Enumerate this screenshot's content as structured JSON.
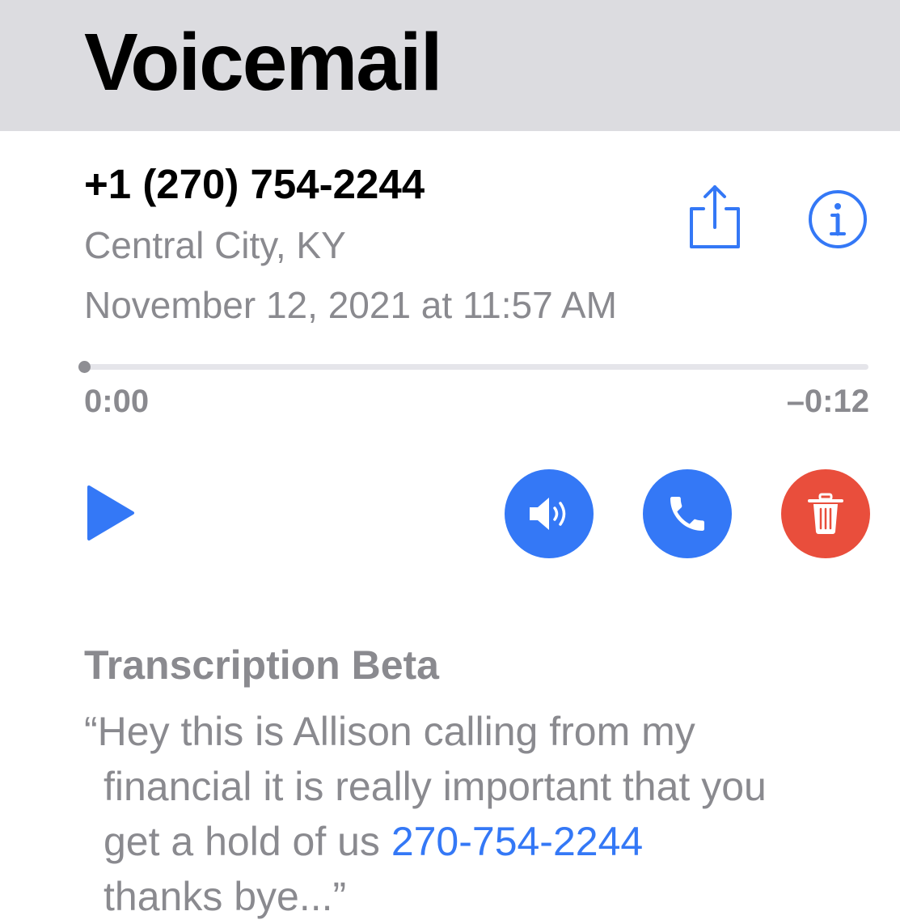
{
  "header": {
    "title": "Voicemail",
    "background": "#dcdce0"
  },
  "voicemail": {
    "number": "+1 (270) 754-2244",
    "location": "Central City, KY",
    "date": "November 12, 2021 at 11:57 AM"
  },
  "actions": {
    "share_icon": "share-icon",
    "info_icon": "info-icon",
    "accent": "#3478f6"
  },
  "player": {
    "progress": 0,
    "elapsed": "0:00",
    "remaining": "–0:12",
    "play_icon": "play-icon"
  },
  "buttons": {
    "speaker": {
      "icon": "speaker-icon",
      "color": "#3478f6"
    },
    "call": {
      "icon": "phone-icon",
      "color": "#3478f6"
    },
    "delete": {
      "icon": "trash-icon",
      "color": "#e94e3c"
    }
  },
  "transcription": {
    "title": "Transcription Beta",
    "line1": "“Hey this is Allison calling from my",
    "line2": "financial it is really important that you",
    "line3_text": "get a hold of us ",
    "phone_link": "270-754-2244",
    "line4": "thanks bye...”",
    "link_color": "#3478f6"
  }
}
